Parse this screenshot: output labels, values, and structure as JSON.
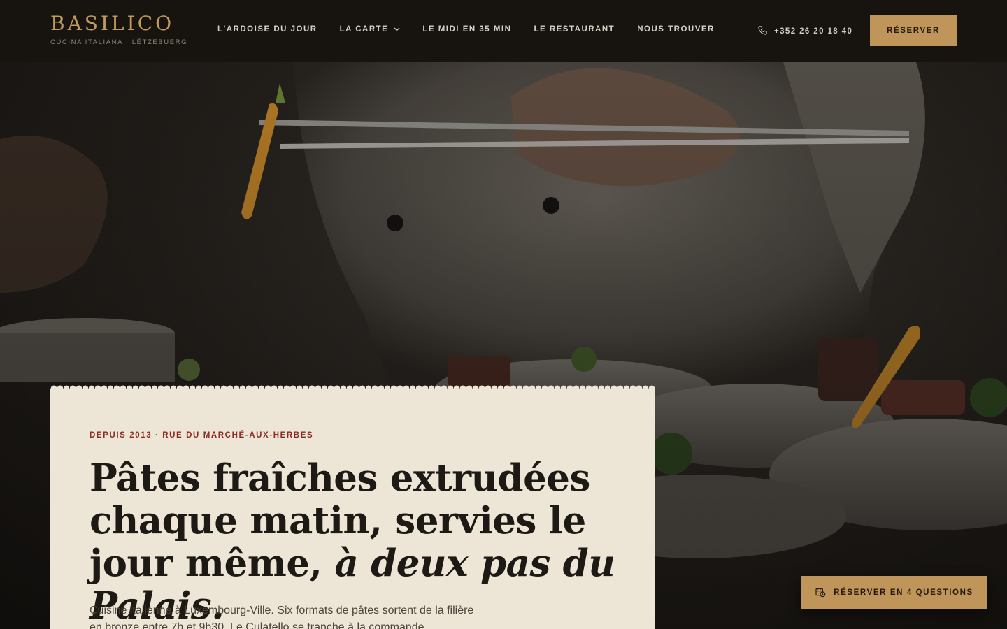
{
  "brand": {
    "name": "BASILICO",
    "tagline": "CUCINA ITALIANA · LËTZEBUERG"
  },
  "nav": {
    "items": [
      {
        "label": "L'ARDOISE DU JOUR"
      },
      {
        "label": "LA CARTE",
        "has_dropdown": true
      },
      {
        "label": "LE MIDI EN 35 MIN"
      },
      {
        "label": "LE RESTAURANT"
      },
      {
        "label": "NOUS TROUVER"
      }
    ],
    "phone": "+352 26 20 18 40",
    "reserve_label": "RÉSERVER"
  },
  "hero": {
    "image_icons": "chef-plating-photo",
    "eyebrow": "DEPUIS 2013 · RUE DU MARCHÉ-AUX-HERBES",
    "headline_main": "Pâtes fraîches extrudées chaque matin, servies le jour même, ",
    "headline_emphasis": "à deux pas du Palais.",
    "lede": "Cuisine italienne à Luxembourg-Ville. Six formats de pâtes sortent de la filière en bronze entre 7h et 9h30. Le Culatello se tranche à la commande."
  },
  "floating_cta": {
    "label": "RÉSERVER EN 4 QUESTIONS",
    "icon": "calendar-clock-icon"
  },
  "colors": {
    "accent": "#bf955a",
    "header_bg": "#17140f",
    "card_bg": "#ede5d5",
    "eyebrow_red": "#8c2a22"
  }
}
